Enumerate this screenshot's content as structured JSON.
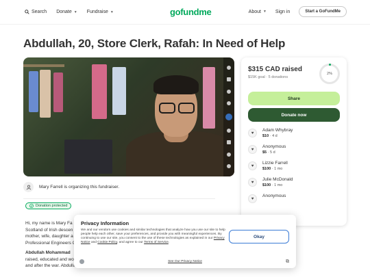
{
  "header": {
    "search_label": "Search",
    "donate_label": "Donate",
    "fundraise_label": "Fundraise",
    "logo": "gofundme",
    "about_label": "About",
    "signin_label": "Sign in",
    "start_label": "Start a GoFundMe"
  },
  "campaign": {
    "title": "Abdullah, 20, Store Clerk, Rafah: In Need of Help",
    "organizer": "Mary Farrell is organizing this fundraiser.",
    "protected_label": "Donation protected",
    "story_line1": "Hi, my name is Mary Fa",
    "story_line2": "Scotland of Irish descen",
    "story_line3": "mother, wife, daughter a",
    "story_line4": "Professional Engineers C",
    "story_bold": "Abdullah Mohammad",
    "story_line6": "raised, educated and wo",
    "story_line7": "and after the war. Abdullah is 20, and the income from his employment supports his parents"
  },
  "donation": {
    "raised": "$315 CAD raised",
    "goal": "$15K goal · 5 donations",
    "percent": "2%",
    "share_label": "Share",
    "donate_label": "Donate now",
    "donors": [
      {
        "name": "Adam Whybray",
        "amount": "$10",
        "when": "· 4 d"
      },
      {
        "name": "Anonymous",
        "amount": "$5",
        "when": "· 5 d"
      },
      {
        "name": "Lizzie Farrell",
        "amount": "$100",
        "when": "· 1 mo"
      },
      {
        "name": "Julie McDonald",
        "amount": "$100",
        "when": "· 1 mo"
      },
      {
        "name": "Anonymous",
        "amount": "",
        "when": ""
      }
    ]
  },
  "privacy": {
    "title": "Privacy Information",
    "text_part1": "We and our vendors use cookies and similar technologies that analyze how you use our site to help people help each other, save your preferences, and provide you with meaningful experiences. By continuing to use our site, you consent to the use of these technologies as explained in our ",
    "link1": "Privacy Notice",
    "text_and": " and ",
    "link2": "Cookie Policy",
    "text_part2": ", and agree to our ",
    "link3": "Terms of Service",
    "text_end": ".",
    "okay_label": "Okay",
    "footer_link": "See Our Privacy Notice"
  }
}
